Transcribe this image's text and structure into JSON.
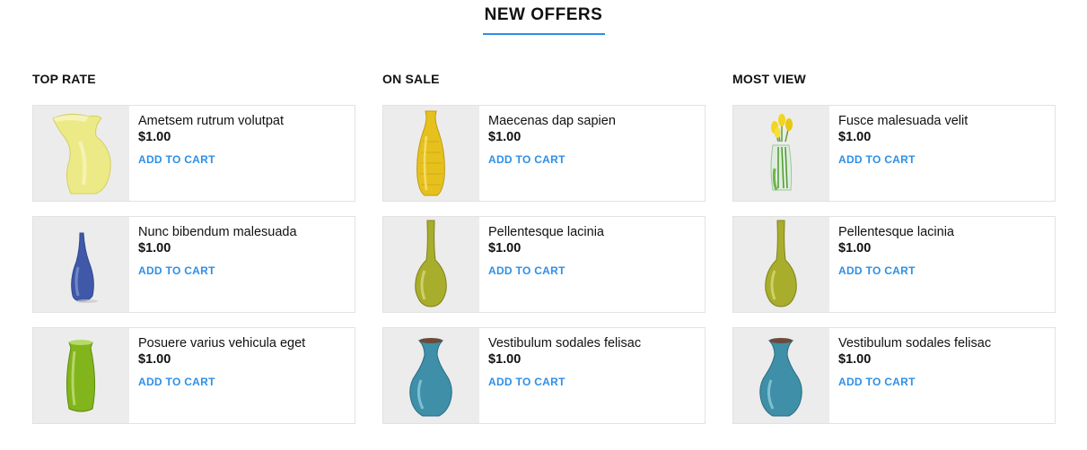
{
  "section": {
    "title": "NEW OFFERS",
    "accent": "#2e8fe6"
  },
  "columns": [
    {
      "heading": "TOP RATE",
      "products": [
        {
          "name": "Ametsem rutrum volutpat",
          "price": "$1.00",
          "cta": "ADD TO CART",
          "image_icon": "yellow-pitcher-vase-icon"
        },
        {
          "name": "Nunc bibendum malesuada",
          "price": "$1.00",
          "cta": "ADD TO CART",
          "image_icon": "blue-bud-vase-icon"
        },
        {
          "name": "Posuere varius vehicula eget",
          "price": "$1.00",
          "cta": "ADD TO CART",
          "image_icon": "green-cylinder-vase-icon"
        }
      ]
    },
    {
      "heading": "ON SALE",
      "products": [
        {
          "name": "Maecenas dap sapien",
          "price": "$1.00",
          "cta": "ADD TO CART",
          "image_icon": "yellow-tall-vase-icon"
        },
        {
          "name": "Pellentesque lacinia",
          "price": "$1.00",
          "cta": "ADD TO CART",
          "image_icon": "olive-bottle-vase-icon"
        },
        {
          "name": "Vestibulum sodales felisac",
          "price": "$1.00",
          "cta": "ADD TO CART",
          "image_icon": "teal-urn-vase-icon"
        }
      ]
    },
    {
      "heading": "MOST VIEW",
      "products": [
        {
          "name": "Fusce malesuada velit",
          "price": "$1.00",
          "cta": "ADD TO CART",
          "image_icon": "tulip-glass-vase-icon"
        },
        {
          "name": "Pellentesque lacinia",
          "price": "$1.00",
          "cta": "ADD TO CART",
          "image_icon": "olive-bottle-vase-icon"
        },
        {
          "name": "Vestibulum sodales felisac",
          "price": "$1.00",
          "cta": "ADD TO CART",
          "image_icon": "teal-urn-vase-icon"
        }
      ]
    }
  ]
}
